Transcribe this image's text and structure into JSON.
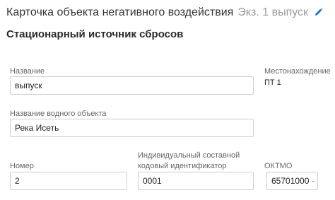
{
  "header": {
    "title": "Карточка объекта негативного воздействия",
    "subtitle": "Экз. 1 выпуск",
    "edit_icon": "pencil-icon",
    "accent_color": "#1a73c7"
  },
  "section": {
    "title": "Стационарный источник сбросов"
  },
  "fields": {
    "name": {
      "label": "Название",
      "value": "выпуск"
    },
    "location": {
      "label": "Местонахождение",
      "value": "ПТ 1"
    },
    "water_body": {
      "label": "Название водного объекта",
      "value": "Река Исеть"
    },
    "number": {
      "label": "Номер",
      "value": "2"
    },
    "identifier": {
      "label_line1": "Индивидуальный составной",
      "label_line2": "кодовый идентификатор",
      "value": "0001"
    },
    "oktmo": {
      "label": "ОКТМО",
      "value": "65701000",
      "icon": "chevron-down-icon"
    }
  }
}
